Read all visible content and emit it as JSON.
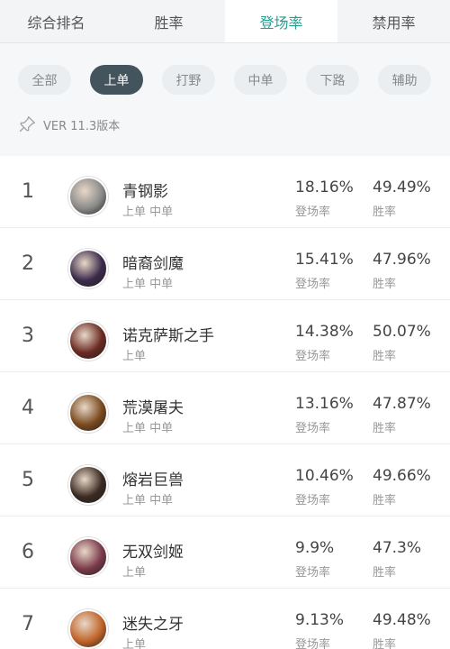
{
  "tabs": [
    {
      "label": "综合排名",
      "active": false
    },
    {
      "label": "胜率",
      "active": false
    },
    {
      "label": "登场率",
      "active": true
    },
    {
      "label": "禁用率",
      "active": false
    }
  ],
  "filters": [
    {
      "label": "全部",
      "active": false
    },
    {
      "label": "上单",
      "active": true
    },
    {
      "label": "打野",
      "active": false
    },
    {
      "label": "中单",
      "active": false
    },
    {
      "label": "下路",
      "active": false
    },
    {
      "label": "辅助",
      "active": false
    }
  ],
  "version": "VER 11.3版本",
  "colors": {
    "accent": "#2a9d8f",
    "active_chip": "#44545d"
  },
  "champions": [
    {
      "rank": "1",
      "name": "青钢影",
      "roles": "上单 中单",
      "pick_rate": "18.16%",
      "pick_label": "登场率",
      "win_rate": "49.49%",
      "win_label": "胜率",
      "avatar_color": "#8a8a8a"
    },
    {
      "rank": "2",
      "name": "暗裔剑魔",
      "roles": "上单 中单",
      "pick_rate": "15.41%",
      "pick_label": "登场率",
      "win_rate": "47.96%",
      "win_label": "胜率",
      "avatar_color": "#3b2a4a"
    },
    {
      "rank": "3",
      "name": "诺克萨斯之手",
      "roles": "上单",
      "pick_rate": "14.38%",
      "pick_label": "登场率",
      "win_rate": "50.07%",
      "win_label": "胜率",
      "avatar_color": "#6a2a22"
    },
    {
      "rank": "4",
      "name": "荒漠屠夫",
      "roles": "上单 中单",
      "pick_rate": "13.16%",
      "pick_label": "登场率",
      "win_rate": "47.87%",
      "win_label": "胜率",
      "avatar_color": "#7a4a1f"
    },
    {
      "rank": "5",
      "name": "熔岩巨兽",
      "roles": "上单 中单",
      "pick_rate": "10.46%",
      "pick_label": "登场率",
      "win_rate": "49.66%",
      "win_label": "胜率",
      "avatar_color": "#3a2a22"
    },
    {
      "rank": "6",
      "name": "无双剑姬",
      "roles": "上单",
      "pick_rate": "9.9%",
      "pick_label": "登场率",
      "win_rate": "47.3%",
      "win_label": "胜率",
      "avatar_color": "#7a3a4a"
    },
    {
      "rank": "7",
      "name": "迷失之牙",
      "roles": "上单",
      "pick_rate": "9.13%",
      "pick_label": "登场率",
      "win_rate": "49.48%",
      "win_label": "胜率",
      "avatar_color": "#c0652a"
    }
  ]
}
